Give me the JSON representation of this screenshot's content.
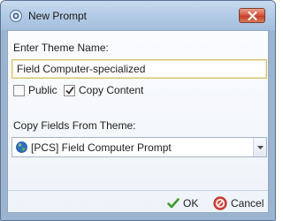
{
  "window": {
    "title": "New Prompt"
  },
  "form": {
    "theme_name_label": "Enter Theme Name:",
    "theme_name_value": "Field Computer-specialized",
    "public_label": "Public",
    "public_checked": false,
    "copy_content_label": "Copy Content",
    "copy_content_checked": true,
    "copy_fields_label": "Copy Fields From Theme:",
    "copy_fields_selected": "[PCS] Field Computer Prompt"
  },
  "footer": {
    "ok_label": "OK",
    "cancel_label": "Cancel"
  },
  "icons": {
    "app": "app-icon",
    "close": "close-icon",
    "globe": "globe-icon",
    "ok": "check-icon",
    "cancel": "cancel-icon",
    "dropdown": "chevron-down-icon"
  }
}
